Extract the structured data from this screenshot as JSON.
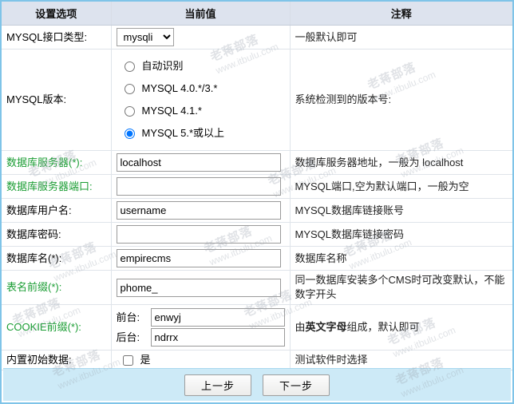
{
  "table": {
    "headers": [
      "设置选项",
      "当前值",
      "注释"
    ]
  },
  "rows": {
    "interface": {
      "label": "MYSQL接口类型:",
      "selected": "mysqli",
      "options": [
        "mysqli",
        "mysql"
      ],
      "note": "一般默认即可"
    },
    "version": {
      "label": "MYSQL版本:",
      "options": [
        {
          "label": "自动识别",
          "checked": false
        },
        {
          "label": "MYSQL 4.0.*/3.*",
          "checked": false
        },
        {
          "label": "MYSQL 4.1.*",
          "checked": false
        },
        {
          "label": "MYSQL 5.*或以上",
          "checked": true
        }
      ],
      "note": "系统检测到的版本号:"
    },
    "db_server": {
      "label": "数据库服务器(*):",
      "value": "localhost",
      "note": "数据库服务器地址，一般为 localhost"
    },
    "db_port": {
      "label": "数据库服务器端口:",
      "value": "",
      "note": "MYSQL端口,空为默认端口，一般为空"
    },
    "db_user": {
      "label": "数据库用户名:",
      "value": "username",
      "note": "MYSQL数据库链接账号"
    },
    "db_password": {
      "label": "数据库密码:",
      "value": "",
      "note": "MYSQL数据库链接密码"
    },
    "db_name": {
      "label": "数据库名(*):",
      "value": "empirecms",
      "note": "数据库名称"
    },
    "table_prefix": {
      "label": "表名前缀(*):",
      "value": "phome_",
      "note": "同一数据库安装多个CMS时可改变默认，不能数字开头"
    },
    "cookie_prefix": {
      "label": "COOKIE前缀(*):",
      "front_label": "前台:",
      "front_value": "enwyj",
      "back_label": "后台:",
      "back_value": "ndrrx",
      "note_pre": "由",
      "note_bold": "英文字母",
      "note_post": "组成，默认即可"
    },
    "init_data": {
      "label": "内置初始数据:",
      "checkbox_label": "是",
      "checked": false,
      "note": "测试软件时选择"
    }
  },
  "footer": {
    "prev_label": "上一步",
    "next_label": "下一步"
  },
  "watermark": {
    "line1": "老蒋部落",
    "line2": "www.itbulu.com"
  }
}
